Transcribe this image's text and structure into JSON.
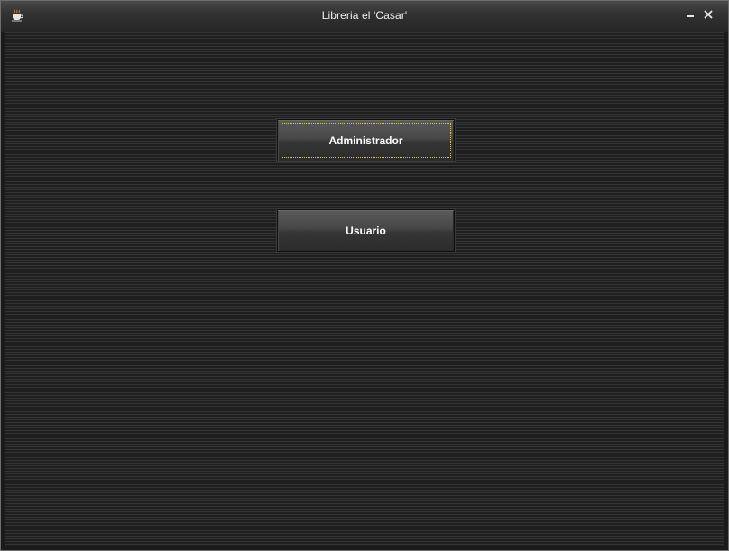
{
  "window": {
    "title": "Libreria el 'Casar'",
    "icon": "java-cup-icon",
    "controls": {
      "minimize": "minimize-icon",
      "close": "close-icon"
    }
  },
  "buttons": {
    "admin_label": "Administrador",
    "user_label": "Usuario"
  },
  "colors": {
    "background": "#1f1f1f",
    "titlebar": "#323232",
    "button": "#474747",
    "focus": "#d8c04a",
    "text": "#ffffff"
  }
}
